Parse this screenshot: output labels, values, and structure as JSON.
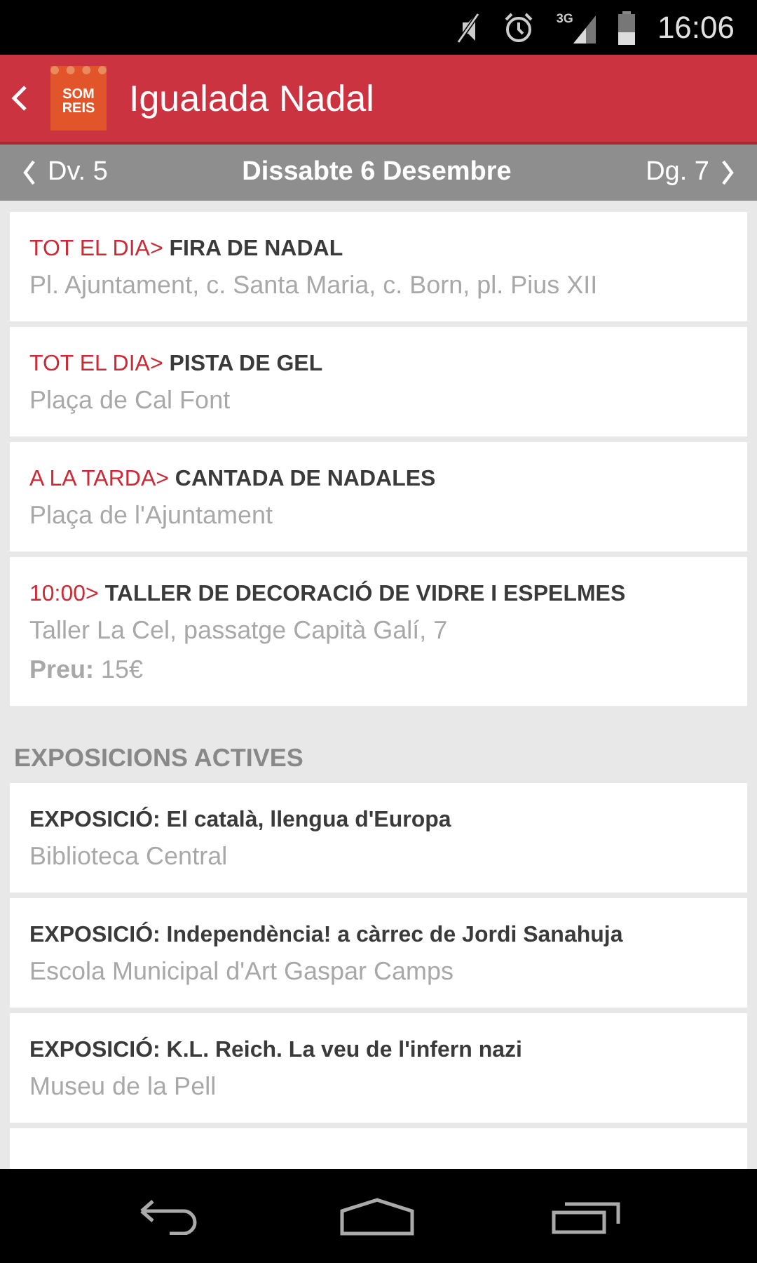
{
  "status_bar": {
    "network": "3G",
    "time": "16:06"
  },
  "app_bar": {
    "logo_text": [
      "SOM",
      "REIS"
    ],
    "title": "Igualada Nadal"
  },
  "day_nav": {
    "previous": "Dv. 5",
    "current": "Dissabte 6 Desembre",
    "next": "Dg. 7"
  },
  "events": [
    {
      "time": "TOT EL DIA>",
      "title": "FIRA DE NADAL",
      "place": "Pl. Ajuntament, c. Santa Maria, c. Born, pl. Pius XII"
    },
    {
      "time": "TOT EL DIA>",
      "title": "PISTA DE GEL",
      "place": "Plaça de Cal Font"
    },
    {
      "time": "A LA TARDA>",
      "title": "CANTADA DE NADALES",
      "place": "Plaça de l'Ajuntament"
    },
    {
      "time": "10:00>",
      "title": "TALLER DE DECORACIÓ DE VIDRE I ESPELMES",
      "place": "Taller La Cel, passatge Capità Galí, 7",
      "price": "**Preu:** 15€"
    }
  ],
  "exhibitions": {
    "heading": "EXPOSICIONS ACTIVES",
    "items": [
      {
        "title": "EXPOSICIÓ: El català, llengua d'Europa",
        "place": "Biblioteca Central"
      },
      {
        "title": "EXPOSICIÓ: Independència! a càrrec de Jordi Sanahuja",
        "place": "Escola Municipal d'Art Gaspar Camps"
      },
      {
        "title": "EXPOSICIÓ: K.L. Reich. La veu de l'infern nazi",
        "place": "Museu de la Pell"
      }
    ]
  }
}
